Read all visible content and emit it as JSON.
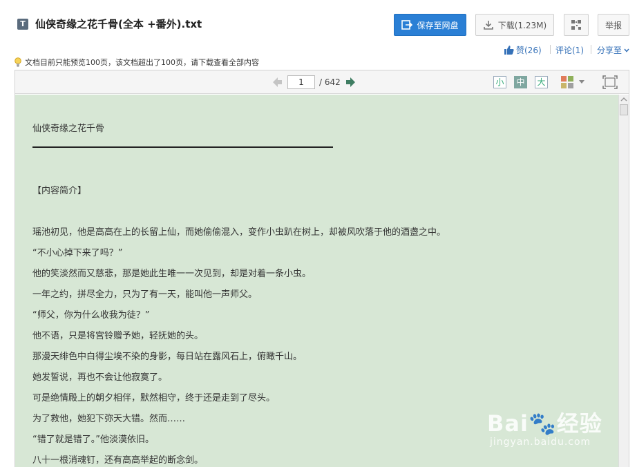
{
  "header": {
    "file_type": "T",
    "title": "仙侠奇缘之花千骨(全本 +番外).txt",
    "save_label": "保存至网盘",
    "download_label": "下载(1.23M)",
    "report_label": "举报"
  },
  "social": {
    "like_label": "赞(26)",
    "comment_label": "评论(1)",
    "share_label": "分享至"
  },
  "notice": "文档目前只能预览100页，该文档超出了100页，请下载查看全部内容",
  "toolbar": {
    "current_page": "1",
    "total_pages": "/ 642",
    "size_small": "小",
    "size_medium": "中",
    "size_large": "大"
  },
  "content": {
    "book_title": "仙侠奇缘之花千骨",
    "section_heading": "【内容简介】",
    "paragraphs": [
      "瑶池初见，他是高高在上的长留上仙，而她偷偷混入，变作小虫趴在树上，却被风吹落于他的酒盏之中。",
      "“不小心掉下来了吗？”",
      "他的笑淡然而又慈悲，那是她此生唯一一次见到，却是对着一条小虫。",
      "一年之约，拼尽全力，只为了有一天，能叫他一声师父。",
      "“师父，你为什么收我为徒？”",
      "他不语，只是将宫铃赠予她，轻抚她的头。",
      "那漫天绯色中白得尘埃不染的身影，每日站在露风石上，俯瞰千山。",
      "她发誓说，再也不会让他寂寞了。",
      "可是绝情殿上的朝夕相伴，默然相守，终于还是走到了尽头。",
      "为了救他，她犯下弥天大错。然而……",
      "“错了就是错了。”他淡漠依旧。",
      "八十一根消魂钉，还有高高举起的断念剑。"
    ]
  },
  "watermark": {
    "logo": "Bai🐾经验",
    "url": "jingyan.baidu.com"
  },
  "colors": {
    "primary_button": "#2a7fd5",
    "page_background": "#d7e7d5",
    "link": "#3571b8"
  }
}
